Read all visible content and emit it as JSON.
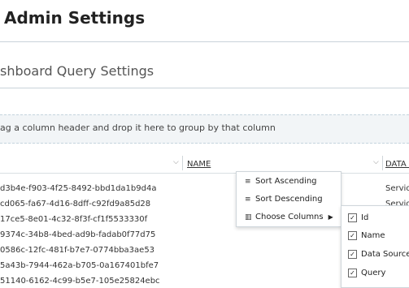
{
  "page": {
    "title": "Admin Settings"
  },
  "section": {
    "title": "shboard Query Settings"
  },
  "group_panel": {
    "hint": "ag a column header and drop it here to group by that column"
  },
  "grid": {
    "columns": [
      {
        "label": ""
      },
      {
        "label": "NAME"
      },
      {
        "label": "DATA S"
      }
    ],
    "rows": [
      {
        "id": "d3b4e-f903-4f25-8492-bbd1da1b9d4a",
        "data_source": "Service"
      },
      {
        "id": "cd065-fa67-4d16-8dff-c92fd9a85d28",
        "data_source": "Service"
      },
      {
        "id": "17ce5-8e01-4c32-8f3f-cf1f5533330f",
        "data_source": ""
      },
      {
        "id": "9374c-34b8-4bed-ad9b-fadab0f77d75",
        "data_source": ""
      },
      {
        "id": "0586c-12fc-481f-b7e7-0774bba3ae53",
        "data_source": ""
      },
      {
        "id": "5a43b-7944-462a-b705-0a167401bfe7",
        "data_source": ""
      },
      {
        "id": "51140-6162-4c99-b5e7-105e25824ebc",
        "data_source": ""
      }
    ]
  },
  "column_menu": {
    "sort_ascending": "Sort Ascending",
    "sort_descending": "Sort Descending",
    "choose_columns": "Choose Columns"
  },
  "columns_submenu": {
    "items": [
      {
        "label": "Id",
        "checked": true
      },
      {
        "label": "Name",
        "checked": true
      },
      {
        "label": "Data Source",
        "checked": true
      },
      {
        "label": "Query",
        "checked": true
      }
    ]
  }
}
